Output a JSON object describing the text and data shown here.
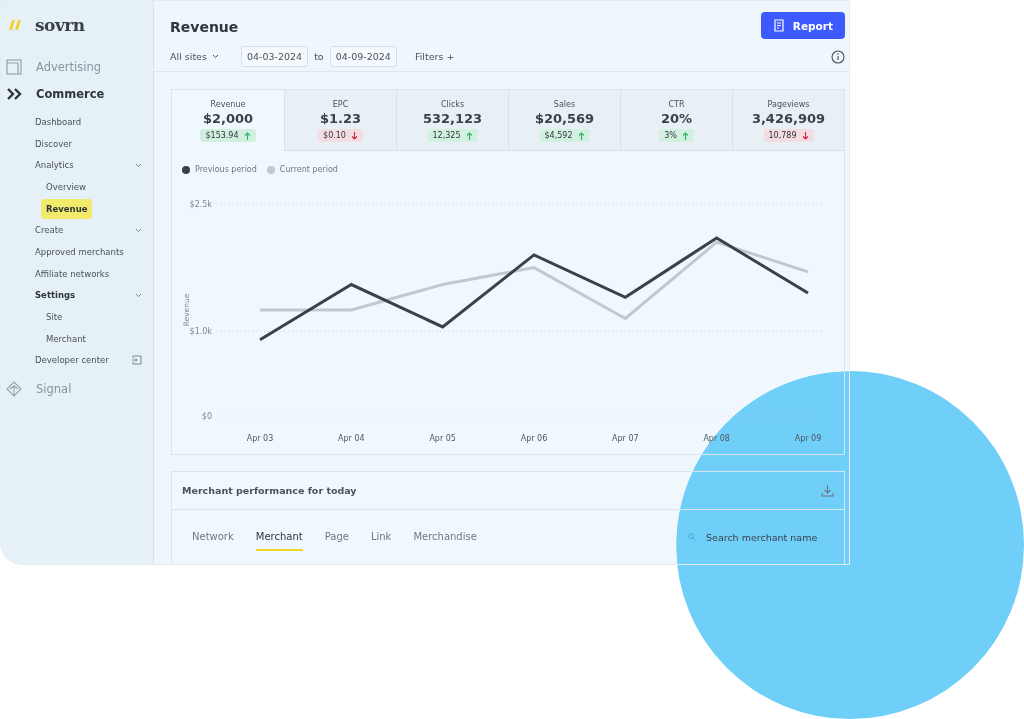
{
  "brand": {
    "name": "sovrn"
  },
  "sidebar": {
    "sections": [
      {
        "label": "Advertising",
        "kind": "frame",
        "active": false
      },
      {
        "label": "Commerce",
        "kind": "chevrons",
        "active": true,
        "items": [
          {
            "label": "Dashboard",
            "active": false,
            "kind": "plain"
          },
          {
            "label": "Discover",
            "active": false,
            "kind": "plain"
          },
          {
            "label": "Analytics",
            "active": false,
            "kind": "collapsible",
            "children": [
              {
                "label": "Overview",
                "selected": false
              },
              {
                "label": "Revenue",
                "selected": true
              }
            ]
          },
          {
            "label": "Create",
            "active": false,
            "kind": "collapsible"
          },
          {
            "label": "Approved merchants",
            "active": false,
            "kind": "plain"
          },
          {
            "label": "Affiliate networks",
            "active": false,
            "kind": "plain"
          },
          {
            "label": "Settings",
            "active": true,
            "kind": "collapsible",
            "children": [
              {
                "label": "Site",
                "selected": false
              },
              {
                "label": "Merchant",
                "selected": false
              }
            ]
          },
          {
            "label": "Developer center",
            "active": false,
            "kind": "external"
          }
        ]
      },
      {
        "label": "Signal",
        "kind": "diamond",
        "active": false
      }
    ]
  },
  "header": {
    "title": "Revenue",
    "report_button": "Report",
    "site_select": "All sites",
    "date_from": "04-03-2024",
    "date_separator": "to",
    "date_to": "04-09-2024",
    "filters": "Filters +"
  },
  "metrics": [
    {
      "label": "Revenue",
      "value": "$2,000",
      "delta": "$153.94",
      "kind": "up",
      "selected": true
    },
    {
      "label": "EPC",
      "value": "$1.23",
      "delta": "$0.10",
      "kind": "down",
      "selected": false
    },
    {
      "label": "Clicks",
      "value": "532,123",
      "delta": "12,325",
      "kind": "up",
      "selected": false
    },
    {
      "label": "Sales",
      "value": "$20,569",
      "delta": "$4,592",
      "kind": "up",
      "selected": false
    },
    {
      "label": "CTR",
      "value": "20%",
      "delta": "3%",
      "kind": "up",
      "selected": false
    },
    {
      "label": "Pageviews",
      "value": "3,426,909",
      "delta": "10,789",
      "kind": "down",
      "selected": false
    }
  ],
  "chart_data": {
    "type": "line",
    "ylabel": "Revenue",
    "categories": [
      "Apr 03",
      "Apr 04",
      "Apr 05",
      "Apr 06",
      "Apr 07",
      "Apr 08",
      "Apr 09"
    ],
    "series": [
      {
        "name": "Previous period",
        "color": "#3b4149",
        "values": [
          900,
          1550,
          1050,
          1900,
          1400,
          2100,
          1450
        ]
      },
      {
        "name": "Current period",
        "color": "#c3c8ce",
        "values": [
          1250,
          1250,
          1550,
          1750,
          1150,
          2050,
          1700
        ]
      }
    ],
    "ylim": [
      0,
      2500
    ],
    "yticks": [
      {
        "value": 0,
        "label": "$0"
      },
      {
        "value": 1000,
        "label": "$1.0k"
      },
      {
        "value": 2500,
        "label": "$2.5k"
      }
    ]
  },
  "merchant_panel": {
    "title": "Merchant performance for today",
    "tabs": [
      {
        "label": "Network",
        "selected": false
      },
      {
        "label": "Merchant",
        "selected": true
      },
      {
        "label": "Page",
        "selected": false
      },
      {
        "label": "Link",
        "selected": false
      },
      {
        "label": "Merchandise",
        "selected": false
      }
    ],
    "search": {
      "placeholder": "Search merchant name"
    }
  }
}
